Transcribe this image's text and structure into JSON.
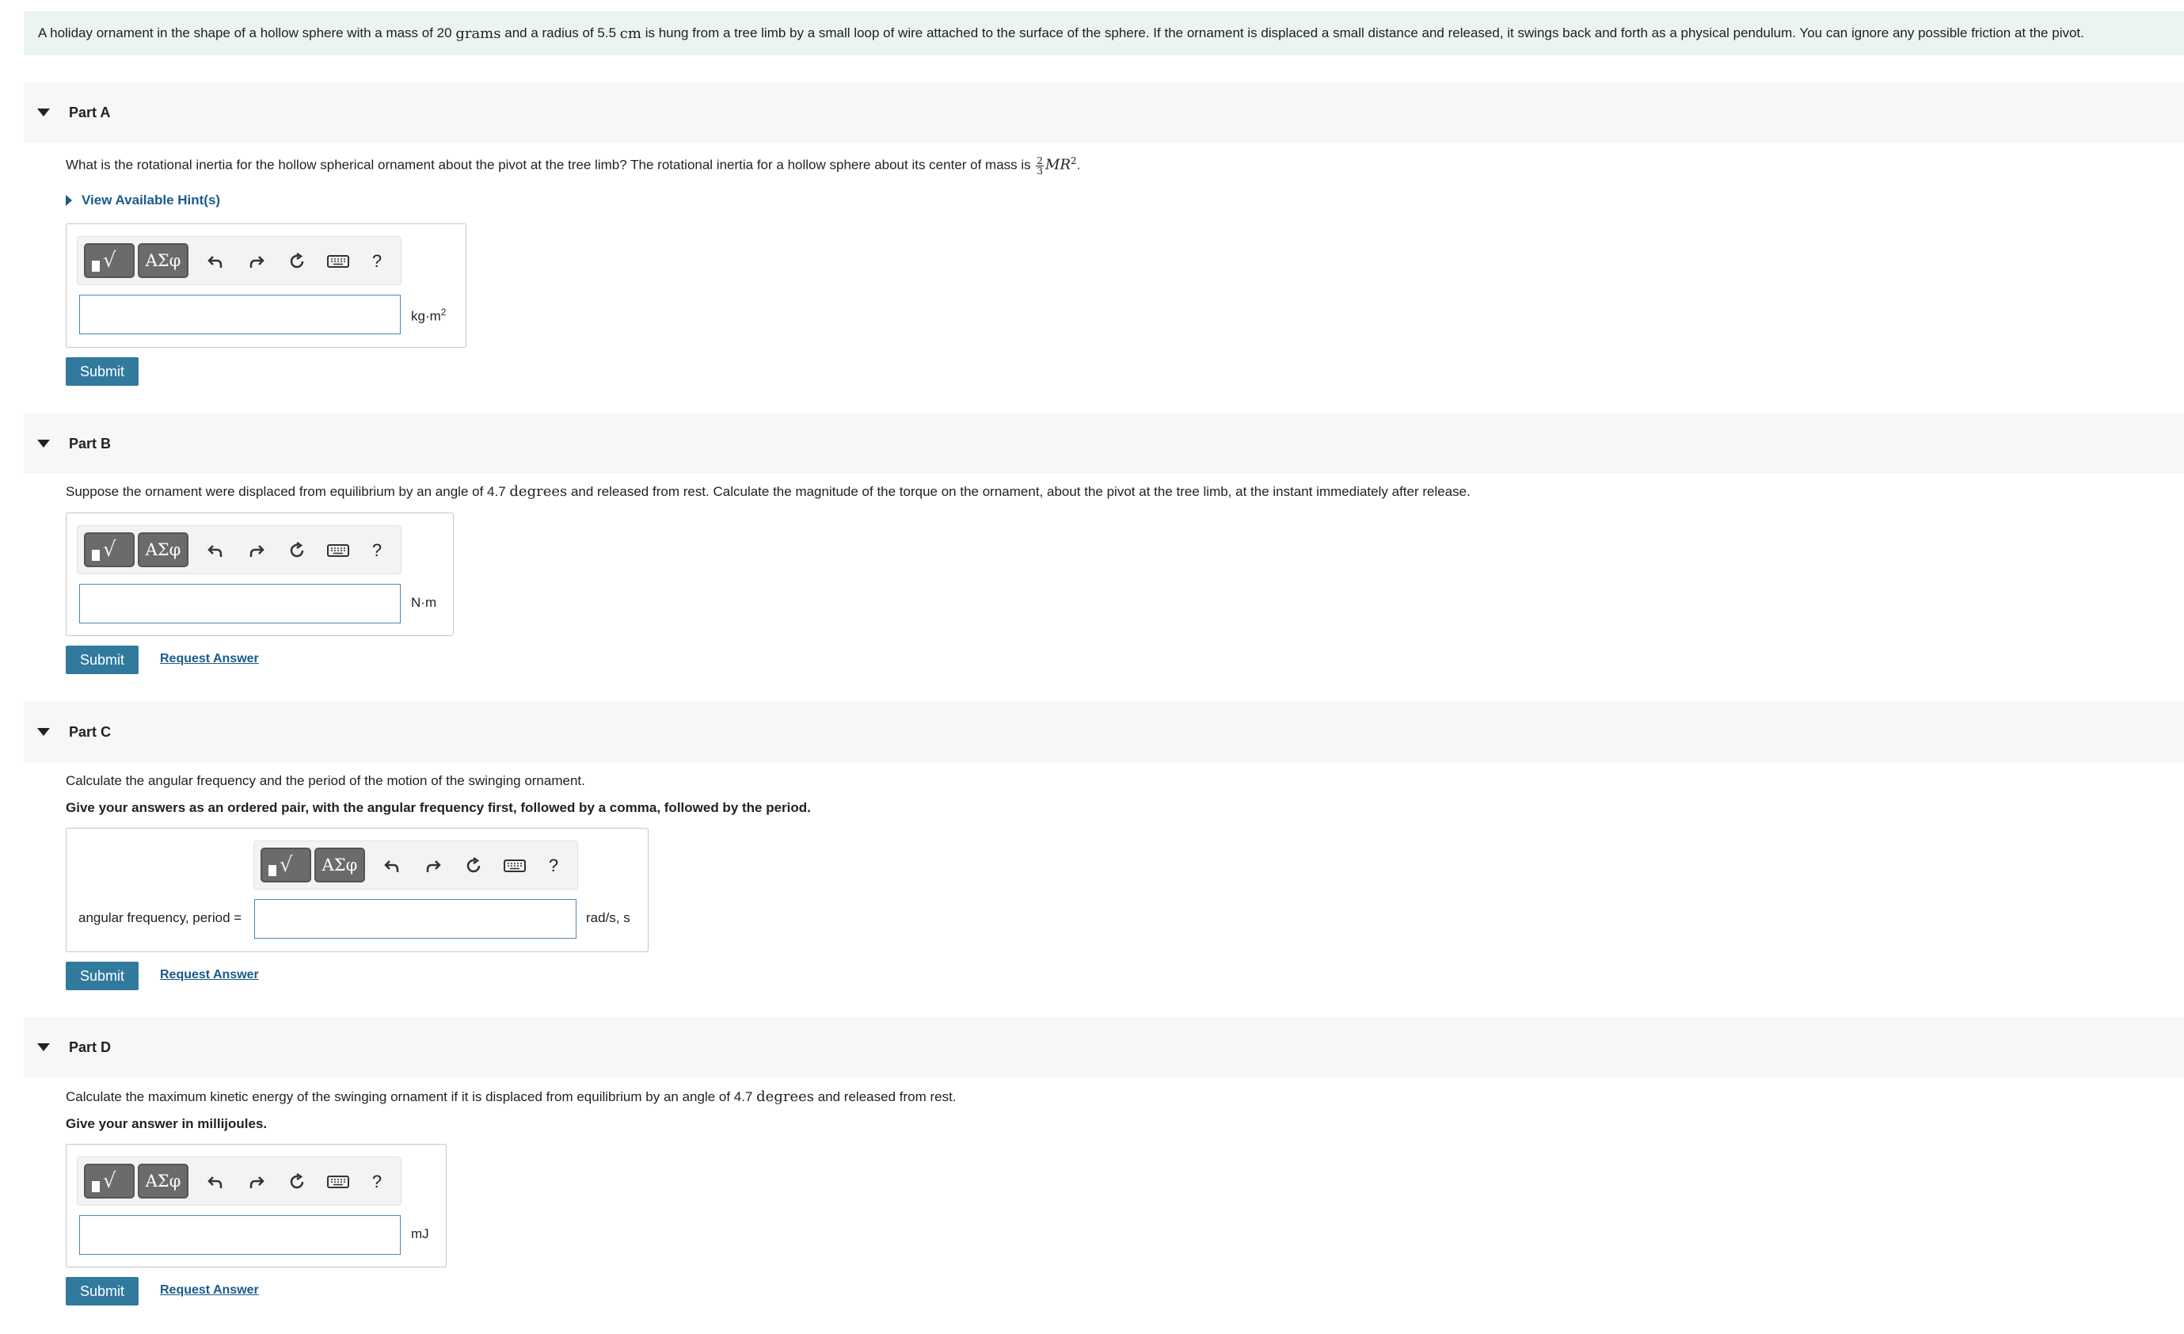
{
  "problem": {
    "p1": "A holiday ornament in the shape of a hollow sphere with a mass of 20 ",
    "u1": "grams",
    "p2": " and a radius of 5.5 ",
    "u2": "cm",
    "p3": " is hung from a tree limb by a small loop of wire attached to the surface of the sphere. If the ornament is displaced a small distance and released, it swings back and forth as a physical pendulum. You can ignore any possible friction at the pivot."
  },
  "toolbar": {
    "symbols_label": "ΑΣφ",
    "help_label": "?"
  },
  "parts": {
    "a": {
      "title": "Part A",
      "question": "What is the rotational inertia for the hollow spherical ornament about the pivot at the tree limb? The rotational inertia for a hollow sphere about its center of mass is ",
      "frac_num": "2",
      "frac_den": "3",
      "formula": "MR",
      "formula_exp": "2",
      "period": ".",
      "hint": "View Available Hint(s)",
      "unit": "kg·m",
      "unit_exp": "2",
      "submit": "Submit",
      "input_value": ""
    },
    "b": {
      "title": "Part B",
      "q1": "Suppose the ornament were displaced from equilibrium by an angle of 4.7 ",
      "q_unit": "degrees",
      "q2": " and released from rest. Calculate the magnitude of the torque on the ornament, about the pivot at the tree limb, at the instant immediately after release.",
      "unit": "N·m",
      "submit": "Submit",
      "request": "Request Answer",
      "input_value": ""
    },
    "c": {
      "title": "Part C",
      "question": "Calculate the angular frequency and the period of the motion of the swinging ornament.",
      "instruction": "Give your answers as an ordered pair, with the angular frequency first, followed by a comma, followed by the period.",
      "label": "angular frequency, period =",
      "unit": "rad/s, s",
      "submit": "Submit",
      "request": "Request Answer",
      "input_value": ""
    },
    "d": {
      "title": "Part D",
      "q1": "Calculate the maximum kinetic energy of the swinging ornament if it is displaced from equilibrium by an angle of 4.7 ",
      "q_unit": "degrees",
      "q2": " and released from rest.",
      "instruction": "Give your answer in millijoules.",
      "unit": "mJ",
      "submit": "Submit",
      "request": "Request Answer",
      "input_value": ""
    }
  }
}
